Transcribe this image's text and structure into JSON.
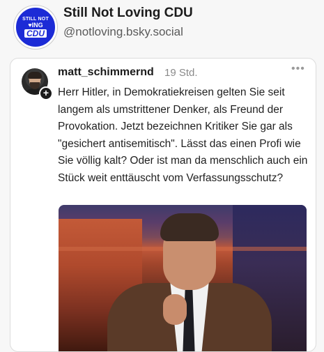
{
  "account": {
    "logo_text": [
      "STILL NOT",
      "♥ING",
      "CDU"
    ],
    "display_name": "Still Not Loving CDU",
    "handle": "@notloving.bsky.social"
  },
  "post": {
    "author": "matt_schimmernd",
    "time": "19 Std.",
    "more_label": "•••",
    "follow_label": "+",
    "text": "Herr Hitler, in Demokratiekreisen gelten Sie seit langem als umstrittener Denker, als Freund der Provokation. Jetzt bezeichnen Kritiker Sie gar als \"gesichert antisemitisch\". Lässt das einen Profi wie Sie völlig kalt? Oder ist man da menschlich auch ein Stück weit enttäuscht vom Verfassungsschutz?"
  },
  "colors": {
    "logo_blue": "#1c2bd6",
    "logo_heart": "#ff2a2a",
    "background": "#f7f7f7",
    "card": "#ffffff"
  },
  "icons": [
    "more-icon",
    "follow-plus-icon"
  ]
}
